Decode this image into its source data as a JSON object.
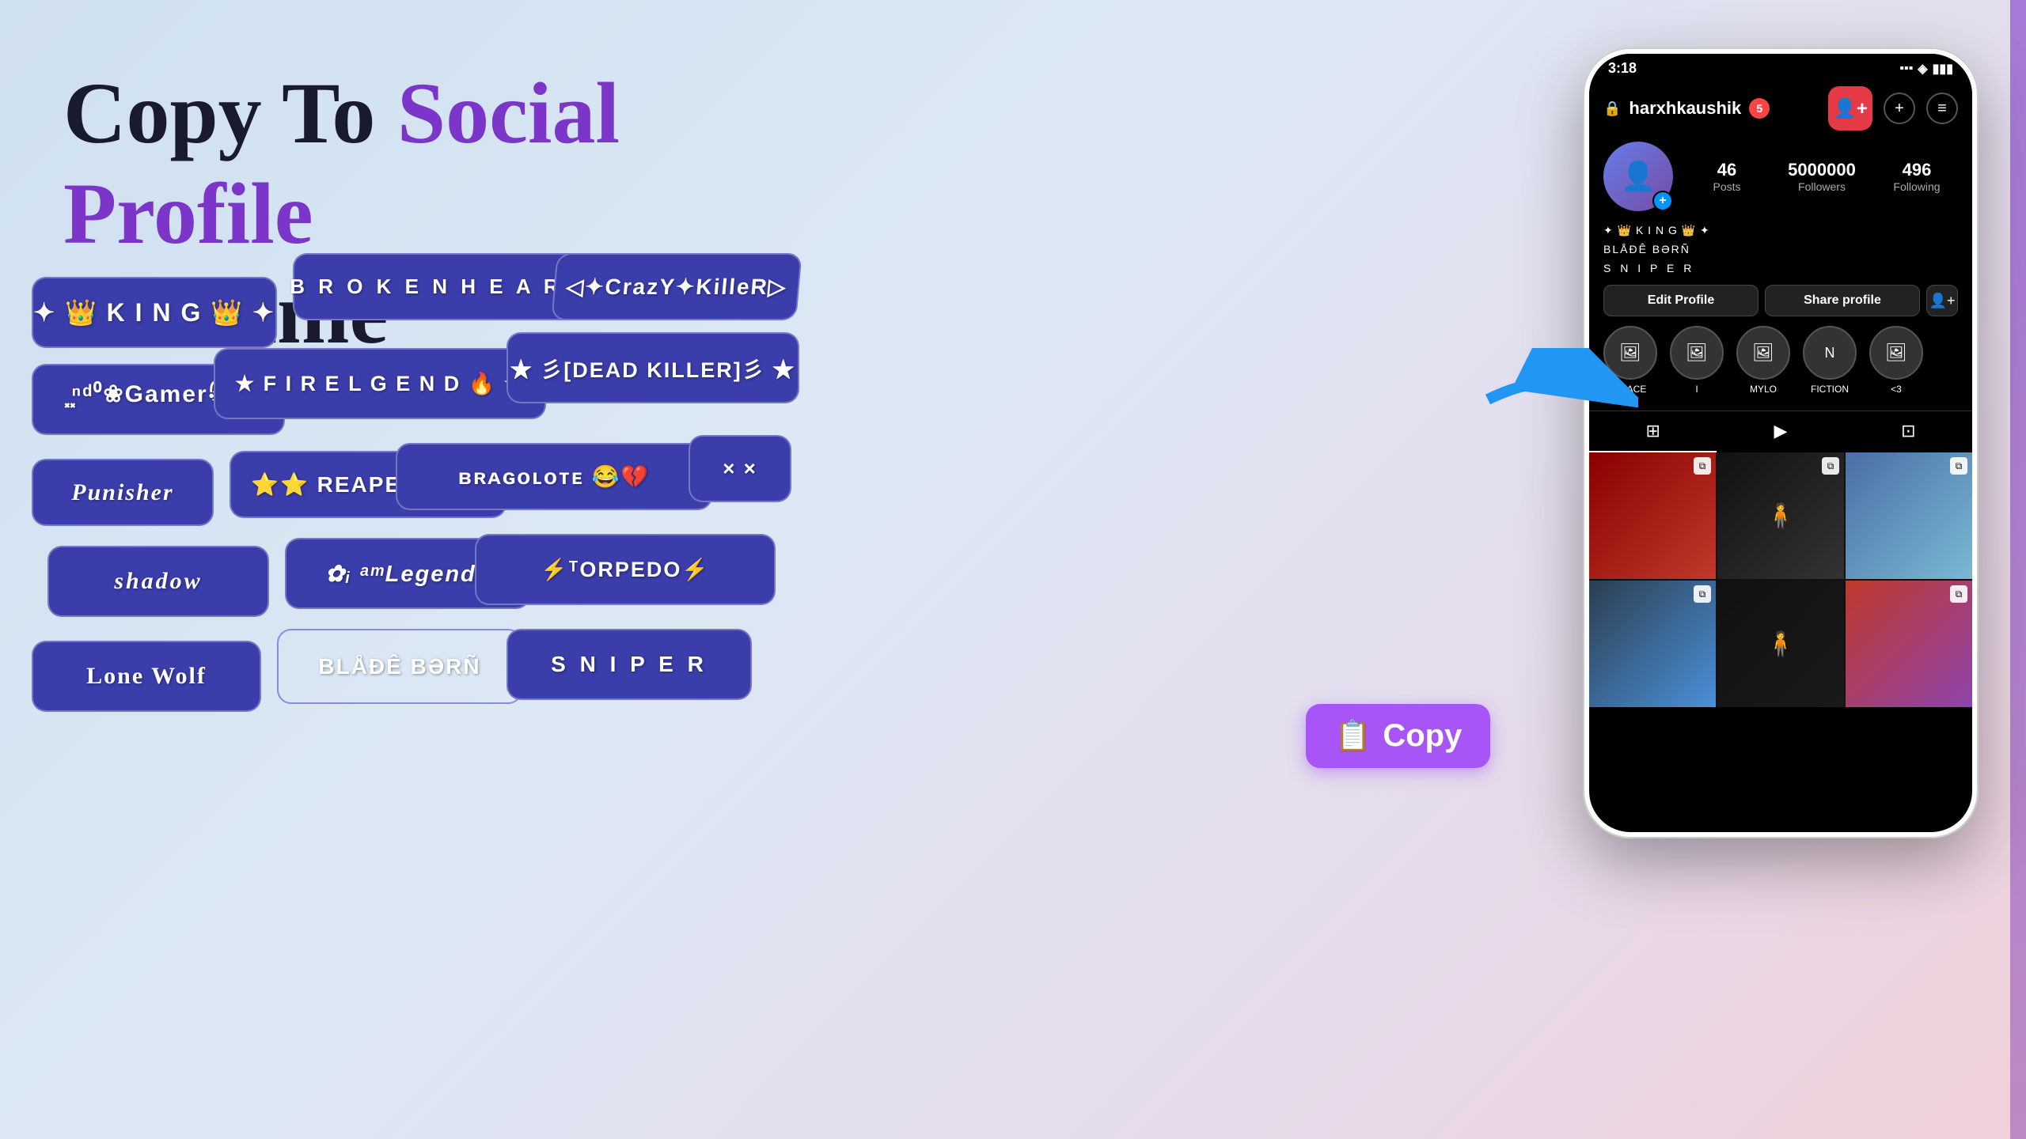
{
  "app": {
    "title": "Copy To Social Profile or Game"
  },
  "headline": {
    "part1": "Copy To ",
    "part2": "Social Profile",
    "part3": " or Game"
  },
  "cards": [
    {
      "id": "king",
      "text": "✦ 👑 K I N G 👑 ✦",
      "style": "card-king"
    },
    {
      "id": "broken",
      "text": "B R O K E N   H E A R T",
      "style": "card-broken"
    },
    {
      "id": "crazy",
      "text": "◁ ✦CrazY✦Killer▷",
      "style": "card-crazy"
    },
    {
      "id": "gamer",
      "text": "❀Gamer ꧂",
      "style": "card-gamer"
    },
    {
      "id": "fire",
      "text": "★ F I R E  L G E N D 🔥 ★",
      "style": "card-fire"
    },
    {
      "id": "dead",
      "text": "★ 彡[DEAD KILLER]彡 ★",
      "style": "card-dead"
    },
    {
      "id": "punisher",
      "text": "P u n i s h e r",
      "style": "card-punisher"
    },
    {
      "id": "reaper",
      "text": "⭐⭐ REAPER ⭐⭐",
      "style": "card-reaper"
    },
    {
      "id": "drago",
      "text": "ʙʀᴀGᴏᴸᴼᴛe 😂💔",
      "style": "card-drago"
    },
    {
      "id": "xx",
      "text": "× ×",
      "style": "card-xx"
    },
    {
      "id": "shadow",
      "text": "s h a d ☯ w",
      "style": "card-shadow"
    },
    {
      "id": "legend",
      "text": "✿Legend᪵ᪧ",
      "style": "card-legend"
    },
    {
      "id": "torpedo",
      "text": "⚡TORPEDO⚡",
      "style": "card-torpedo"
    },
    {
      "id": "lone",
      "text": "Lone Wolf",
      "style": "card-lone"
    },
    {
      "id": "blade",
      "text": "BLÅÐÊ BƏRÑ",
      "style": "card-blade"
    },
    {
      "id": "sniper",
      "text": "S N I P E R",
      "style": "card-sniper"
    }
  ],
  "copy_button": {
    "label": "Copy",
    "icon": "📋"
  },
  "phone": {
    "status_bar": {
      "time": "3:18",
      "signal": "▪▪▪",
      "wifi": "◈",
      "battery": "▮"
    },
    "username": "harxhkaushik",
    "notification_count": "5",
    "stats": {
      "posts_label": "Posts",
      "posts_count": "46",
      "followers_label": "Followers",
      "followers_count": "5000000",
      "following_label": "Following",
      "following_count": "496"
    },
    "bio": {
      "line1": "✦ 👑 K I N G 👑 ✦",
      "line2": "BLÅÐÊ BƏRÑ",
      "line3": "S N I P E R"
    },
    "buttons": {
      "edit": "Edit Profile",
      "share": "Share profile"
    },
    "highlights": [
      {
        "label": "PEACE"
      },
      {
        "label": "I"
      },
      {
        "label": "MYLO"
      },
      {
        "label": "FICTION"
      },
      {
        "label": "<3"
      }
    ],
    "posts_count_display": "5000000"
  }
}
